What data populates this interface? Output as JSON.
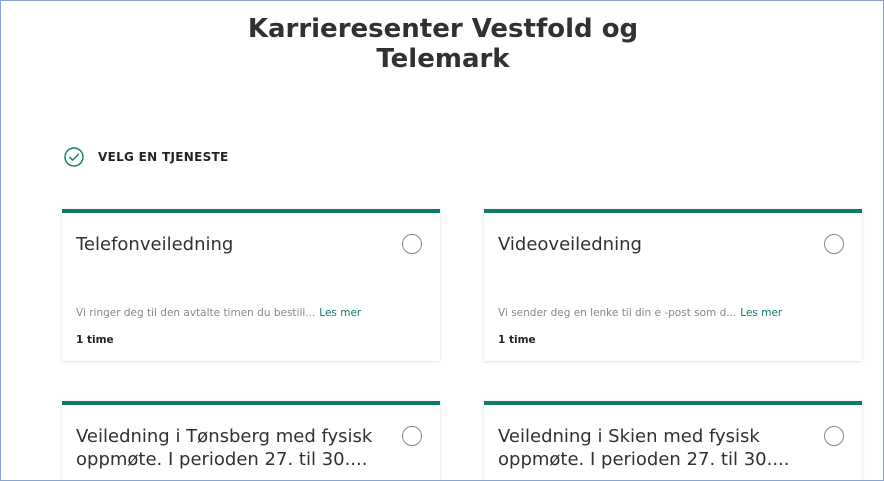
{
  "header": {
    "title_line1": "Karrieresenter Vestfold og",
    "title_line2": "Telemark"
  },
  "step": {
    "icon": "check-circle-icon",
    "label": "VELG EN TJENESTE"
  },
  "services": [
    {
      "title": "Telefonveiledning",
      "description": "Vi ringer deg til den avtalte timen du bestill...",
      "read_more": "Les mer",
      "duration": "1 time"
    },
    {
      "title": "Videoveiledning",
      "description": "Vi sender deg en lenke til din e -post som d...",
      "read_more": "Les mer",
      "duration": "1 time"
    },
    {
      "title": "Veiledning i Tønsberg med fysisk oppmøte. I perioden 27. til 30...."
    },
    {
      "title": "Veiledning i Skien med fysisk oppmøte. I perioden 27. til 30...."
    }
  ],
  "colors": {
    "accent": "#0f7b6c",
    "text": "#252423",
    "muted": "#8a8886"
  }
}
